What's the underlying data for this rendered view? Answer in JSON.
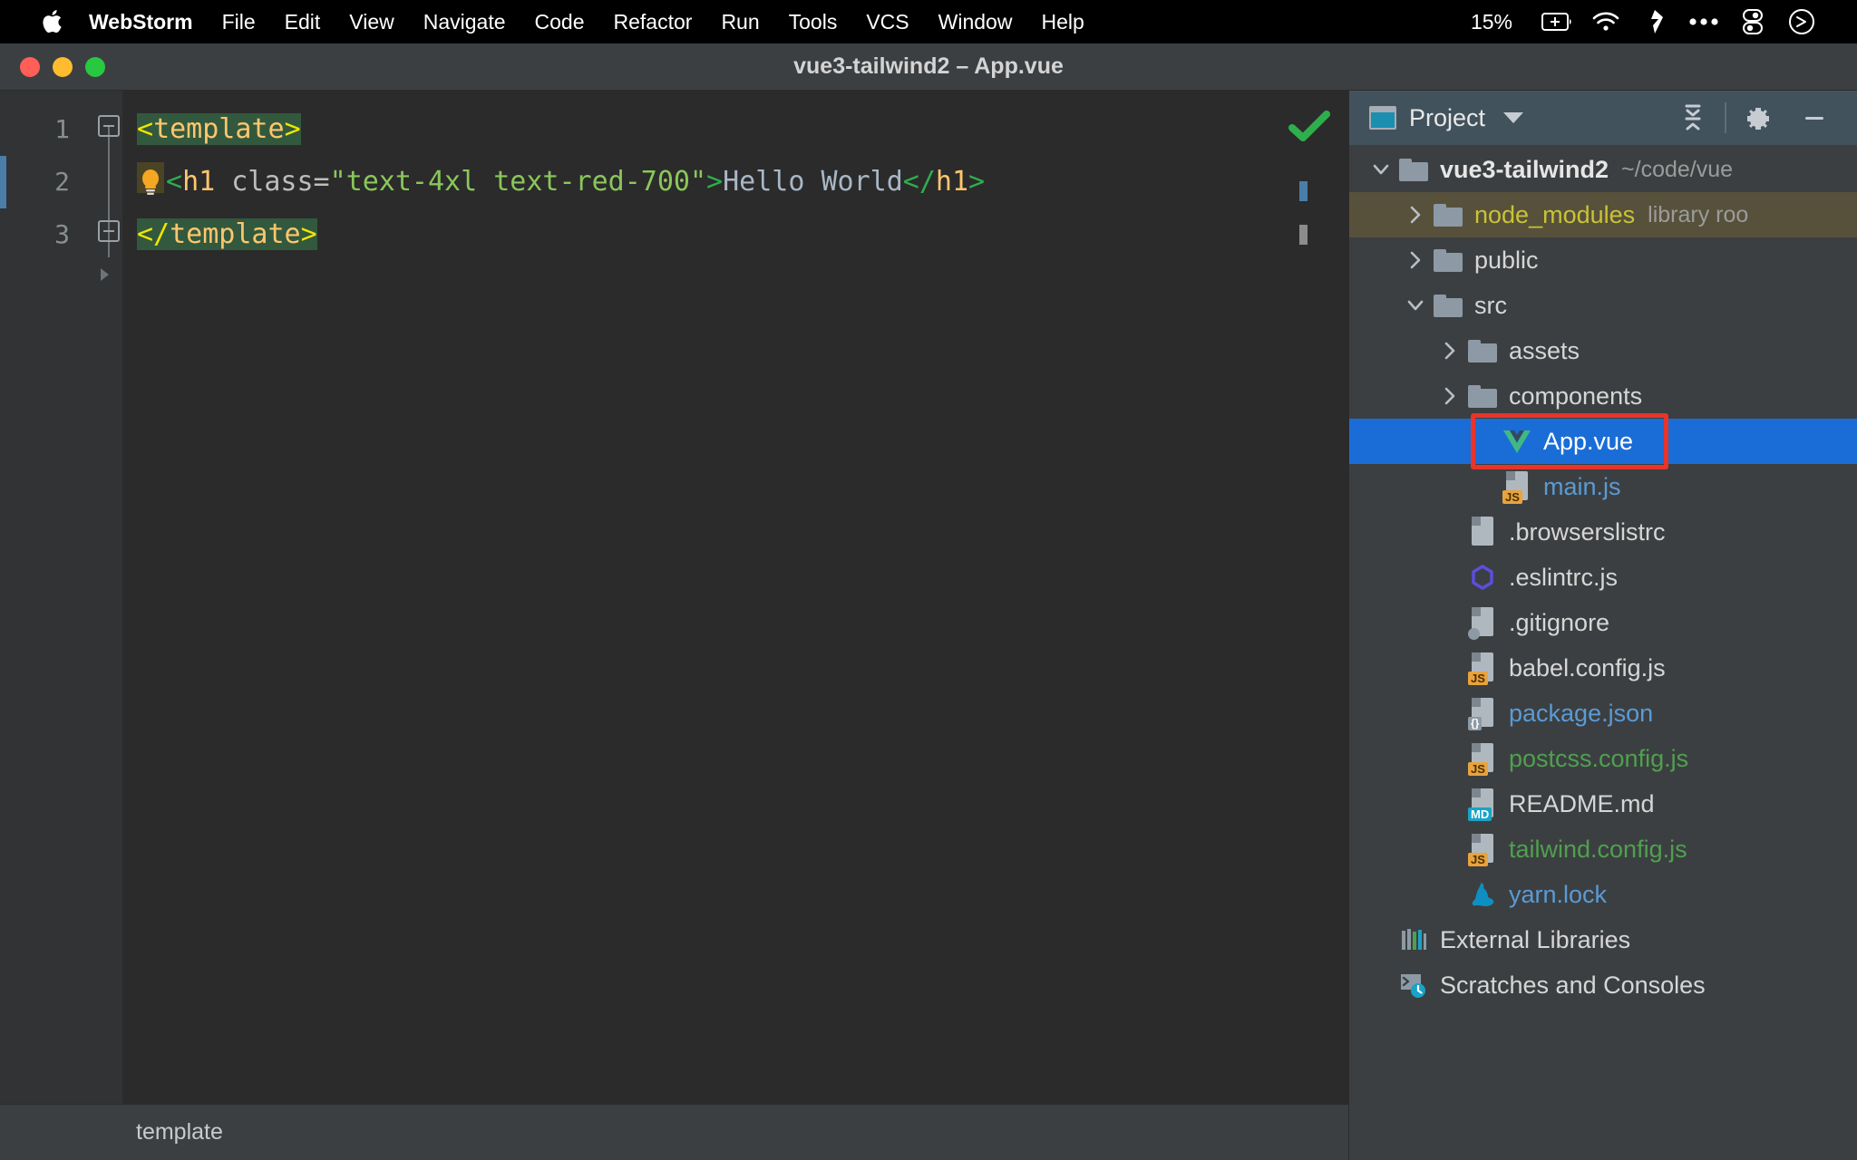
{
  "menubar": {
    "apple_icon": "apple-logo-icon",
    "items": [
      {
        "label": "WebStorm",
        "bold": true
      },
      {
        "label": "File",
        "bold": false
      },
      {
        "label": "Edit",
        "bold": false
      },
      {
        "label": "View",
        "bold": false
      },
      {
        "label": "Navigate",
        "bold": false
      },
      {
        "label": "Code",
        "bold": false
      },
      {
        "label": "Refactor",
        "bold": false
      },
      {
        "label": "Run",
        "bold": false
      },
      {
        "label": "Tools",
        "bold": false
      },
      {
        "label": "VCS",
        "bold": false
      },
      {
        "label": "Window",
        "bold": false
      },
      {
        "label": "Help",
        "bold": false
      }
    ],
    "battery_percent": "15%",
    "status_icons": [
      "battery-icon",
      "wifi-icon",
      "dropbox-icon",
      "ellipsis-icon",
      "control-center-icon",
      "siri-icon"
    ]
  },
  "window": {
    "title": "vue3-tailwind2 – App.vue",
    "traffic_lights": [
      "close-button",
      "minimize-button",
      "zoom-button"
    ]
  },
  "editor": {
    "line_numbers": [
      "1",
      "2",
      "3"
    ],
    "lines": [
      {
        "n": 1,
        "tokens": [
          {
            "text": "<",
            "kind": "angle-yellow",
            "hl": true
          },
          {
            "text": "template",
            "kind": "tag",
            "hl": true
          },
          {
            "text": ">",
            "kind": "angle-yellow",
            "hl": true
          }
        ]
      },
      {
        "n": 2,
        "tokens": [
          {
            "text": "<",
            "kind": "angle-green",
            "hl": false
          },
          {
            "text": "h1",
            "kind": "tag",
            "hl": false
          },
          {
            "text": " class=",
            "kind": "attr",
            "hl": false
          },
          {
            "text": "\"text-4xl text-red-700\"",
            "kind": "string",
            "hl": false
          },
          {
            "text": ">",
            "kind": "angle-green",
            "hl": false
          },
          {
            "text": "Hello World",
            "kind": "text",
            "hl": false
          },
          {
            "text": "</",
            "kind": "angle-green",
            "hl": false
          },
          {
            "text": "h1",
            "kind": "tag",
            "hl": false
          },
          {
            "text": ">",
            "kind": "angle-green",
            "hl": false
          }
        ]
      },
      {
        "n": 3,
        "tokens": [
          {
            "text": "</",
            "kind": "angle-yellow",
            "hl": true
          },
          {
            "text": "template",
            "kind": "tag",
            "hl": true
          },
          {
            "text": ">",
            "kind": "angle-yellow",
            "hl": true
          }
        ]
      }
    ],
    "inspection_status": "check-icon-ok",
    "breadcrumb": "template"
  },
  "project_panel": {
    "title": "Project",
    "window_icon": "project-window-icon",
    "dropdown_icon": "chevron-down-icon",
    "tools": [
      "collapse-all-icon",
      "settings-gear-icon",
      "hide-panel-icon"
    ],
    "tree": [
      {
        "label": "vue3-tailwind2",
        "suffix": "~/code/vue",
        "icon": "folder-icon",
        "arrow": "expanded",
        "depth": 0,
        "color": "white",
        "bold": true,
        "state": "normal"
      },
      {
        "label": "node_modules",
        "suffix": "library roo",
        "icon": "folder-icon",
        "arrow": "collapsed",
        "depth": 1,
        "color": "yellow",
        "bold": false,
        "state": "library"
      },
      {
        "label": "public",
        "suffix": "",
        "icon": "folder-icon",
        "arrow": "collapsed",
        "depth": 1,
        "color": "white",
        "bold": false,
        "state": "normal"
      },
      {
        "label": "src",
        "suffix": "",
        "icon": "folder-icon",
        "arrow": "expanded",
        "depth": 1,
        "color": "white",
        "bold": false,
        "state": "normal"
      },
      {
        "label": "assets",
        "suffix": "",
        "icon": "folder-icon",
        "arrow": "collapsed",
        "depth": 2,
        "color": "white",
        "bold": false,
        "state": "normal"
      },
      {
        "label": "components",
        "suffix": "",
        "icon": "folder-icon",
        "arrow": "collapsed",
        "depth": 2,
        "color": "white",
        "bold": false,
        "state": "normal"
      },
      {
        "label": "App.vue",
        "suffix": "",
        "icon": "vue-icon",
        "arrow": "none",
        "depth": 3,
        "color": "white",
        "bold": false,
        "state": "selected"
      },
      {
        "label": "main.js",
        "suffix": "",
        "icon": "js-file-icon",
        "arrow": "none",
        "depth": 3,
        "color": "blue",
        "bold": false,
        "state": "normal"
      },
      {
        "label": ".browserslistrc",
        "suffix": "",
        "icon": "text-file-icon",
        "arrow": "none",
        "depth": 2,
        "color": "white",
        "bold": false,
        "state": "normal"
      },
      {
        "label": ".eslintrc.js",
        "suffix": "",
        "icon": "eslint-icon",
        "arrow": "none",
        "depth": 2,
        "color": "white",
        "bold": false,
        "state": "normal"
      },
      {
        "label": ".gitignore",
        "suffix": "",
        "icon": "gitignore-icon",
        "arrow": "none",
        "depth": 2,
        "color": "white",
        "bold": false,
        "state": "normal"
      },
      {
        "label": "babel.config.js",
        "suffix": "",
        "icon": "js-file-icon",
        "arrow": "none",
        "depth": 2,
        "color": "white",
        "bold": false,
        "state": "normal"
      },
      {
        "label": "package.json",
        "suffix": "",
        "icon": "json-file-icon",
        "arrow": "none",
        "depth": 2,
        "color": "blue",
        "bold": false,
        "state": "normal"
      },
      {
        "label": "postcss.config.js",
        "suffix": "",
        "icon": "js-file-icon",
        "arrow": "none",
        "depth": 2,
        "color": "green",
        "bold": false,
        "state": "normal"
      },
      {
        "label": "README.md",
        "suffix": "",
        "icon": "md-file-icon",
        "arrow": "none",
        "depth": 2,
        "color": "white",
        "bold": false,
        "state": "normal"
      },
      {
        "label": "tailwind.config.js",
        "suffix": "",
        "icon": "js-file-icon",
        "arrow": "none",
        "depth": 2,
        "color": "green",
        "bold": false,
        "state": "normal"
      },
      {
        "label": "yarn.lock",
        "suffix": "",
        "icon": "yarn-icon",
        "arrow": "none",
        "depth": 2,
        "color": "blue",
        "bold": false,
        "state": "normal"
      },
      {
        "label": "External Libraries",
        "suffix": "",
        "icon": "external-libraries-icon",
        "arrow": "none",
        "depth": 0,
        "color": "white",
        "bold": false,
        "state": "normal"
      },
      {
        "label": "Scratches and Consoles",
        "suffix": "",
        "icon": "scratches-icon",
        "arrow": "none",
        "depth": 0,
        "color": "white",
        "bold": false,
        "state": "normal"
      }
    ],
    "annotation": {
      "target": "App.vue",
      "color": "#e8342a",
      "shape": "rectangle"
    }
  },
  "colors": {
    "accent_selection": "#1a6dd6",
    "annotation_red": "#e8342a",
    "panel_header": "#41525d",
    "editor_bg": "#2b2b2b",
    "chrome_bg": "#3c3f41",
    "string_green": "#8ac75a",
    "tag_yellow": "#ffc66d",
    "library_row": "#57513c"
  }
}
